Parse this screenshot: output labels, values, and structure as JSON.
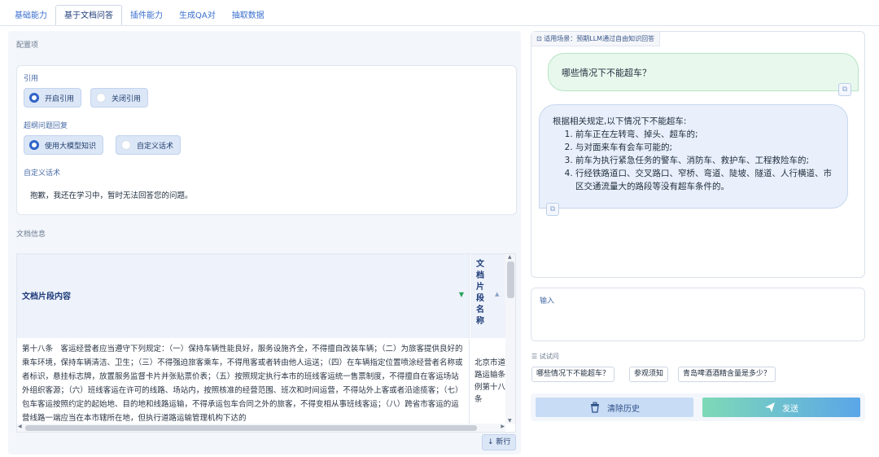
{
  "tabs": [
    "基础能力",
    "基于文档问答",
    "插件能力",
    "生成QA对",
    "抽取数据"
  ],
  "config": {
    "title": "配置项",
    "citation_label": "引用",
    "citation_on": "开启引用",
    "citation_off": "关闭引用",
    "out_of_scope_label": "超纲问题回复",
    "use_llm": "使用大模型知识",
    "custom_script": "自定义话术",
    "custom_script_label": "自定义话术",
    "custom_script_text": "抱歉，我还在学习中，暂时无法回答您的问题。"
  },
  "doc_info": {
    "title": "文档信息",
    "col1": "文档片段内容",
    "col2": "文档片段名称",
    "row1_content": "第十八条　客运经营者应当遵守下列规定：（一）保持车辆性能良好，服务设施齐全，不得擅自改装车辆；（二）为旅客提供良好的乘车环境，保持车辆清洁、卫生；（三）不得强迫旅客乘车，不得甩客或者转由他人运送；（四）在车辆指定位置喷涂经营者名称或者标识，悬挂标志牌，放置服务监督卡片并张贴票价表；（五）按照规定执行本市的班线客运统一售票制度，不得擅自在客运场站外组织客源；（六）班线客运在许可的线路、场站内，按照核准的经营范围、班次和时间运营，不得站外上客或者沿途揽客；（七）包车客运按照约定的起始地、目的地和线路运输，不得承运包车合同之外的旅客，不得变相从事班线客运；（八）跨省市客运的运营线路一端应当在本市辖所在地，但执行道路运输管理机构下达的",
    "row1_name": "北京市道路运输条例第十八条",
    "newline_btn": "↓ 新行"
  },
  "chat": {
    "scene": "适用场景：预期LLM通过自由知识回答",
    "question": "哪些情况下不能超车？",
    "answer_intro": "根据相关规定,以下情况下不能超车:",
    "answer_items": [
      "前车正在左转弯、掉头、超车的;",
      "与对面来车有会车可能的;",
      "前车为执行紧急任务的警车、消防车、救护车、工程救险车的;",
      "行经铁路道口、交叉路口、窄桥、弯道、陡坡、隧道、人行横道、市区交通流量大的路段等没有超车条件的。"
    ]
  },
  "input": {
    "label": "输入",
    "value": ""
  },
  "try": {
    "label": "试试问",
    "suggestions": [
      "哪些情况下不能超车？",
      "参观须知",
      "青岛啤酒酒精含量是多少？"
    ]
  },
  "buttons": {
    "clear": "清除历史",
    "send": "发送"
  }
}
